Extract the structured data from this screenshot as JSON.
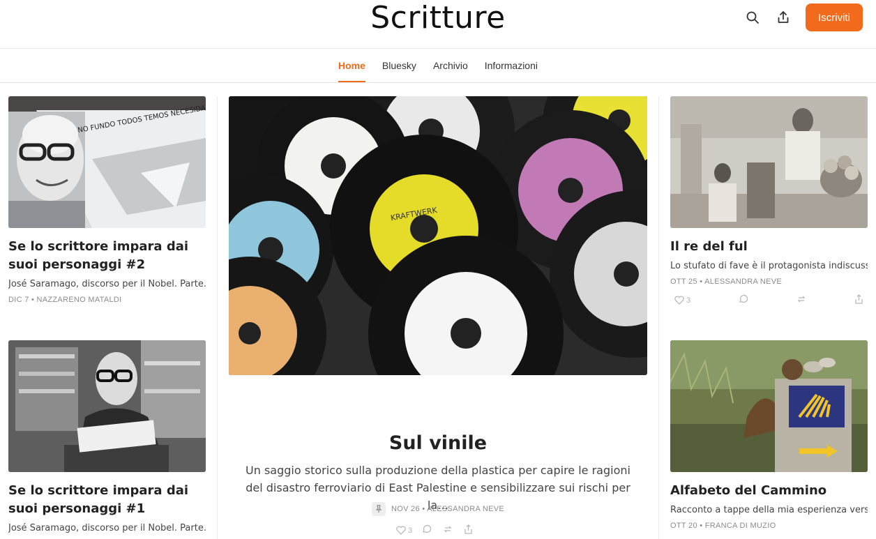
{
  "header": {
    "title": "Scritture",
    "subscribe_label": "Iscriviti",
    "icons": [
      "search-icon",
      "share-icon"
    ]
  },
  "nav": {
    "tabs": [
      {
        "label": "Home",
        "active": true
      },
      {
        "label": "Bluesky",
        "active": false
      },
      {
        "label": "Archivio",
        "active": false
      },
      {
        "label": "Informazioni",
        "active": false
      }
    ]
  },
  "colors": {
    "accent": "#f26a1b",
    "text": "#222222",
    "meta": "#8a8a8a"
  },
  "left_posts": [
    {
      "title": "Se lo scrittore impara dai suoi personaggi #2",
      "subtitle": "José Saramago, discorso per il Nobel. Parte…",
      "meta": "DIC 7 • NAZZARENO MATALDI",
      "image_text": "NO FUNDO TODOS TEMOS NECESIDADE DE DIZER QUEM SOMOS !!!"
    },
    {
      "title": "Se lo scrittore impara dai suoi personaggi #1",
      "subtitle": "José Saramago, discorso per il Nobel. Parte…",
      "meta": ""
    }
  ],
  "featured": {
    "title": "Sul vinile",
    "subtitle": "Un saggio storico sulla produzione della plastica per capire le ragioni del disastro ferroviario di East Palestine e sensibilizzare sui rischi per la…",
    "meta": "NOV 26 • ALESSANDRA NEVE",
    "likes": "3",
    "image_label": "KRAFTWERK"
  },
  "right_posts": [
    {
      "title": "Il re del ful",
      "subtitle": "Lo stufato di fave è il protagonista indiscuss…",
      "meta": "OTT 25 • ALESSANDRA NEVE",
      "likes": "3"
    },
    {
      "title": "Alfabeto del Cammino",
      "subtitle": "Racconto a tappe della mia esperienza verso…",
      "meta": "OTT 20 • FRANCA DI MUZIO"
    }
  ]
}
